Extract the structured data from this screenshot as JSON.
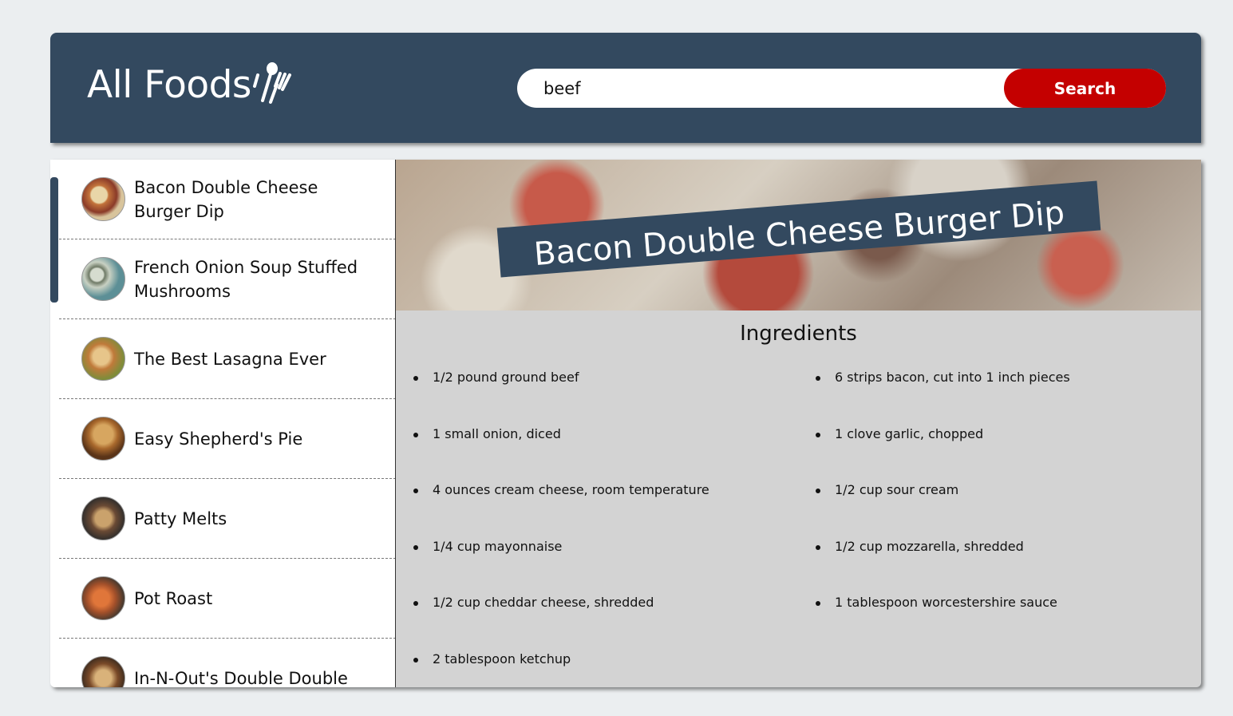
{
  "header": {
    "title": "All Foods",
    "logo_icon": "spoon-fork-icon"
  },
  "search": {
    "value": "beef",
    "button_label": "Search",
    "button_color": "#c40000"
  },
  "colors": {
    "primary": "#33495f",
    "accent": "#c40000",
    "background": "#ebeef0",
    "panel": "#d3d3d3"
  },
  "sidebar": {
    "items": [
      {
        "label": "Bacon Double Cheese Burger Dip",
        "thumb": "bacon-burger-dip-thumbnail"
      },
      {
        "label": "French Onion Soup Stuffed Mushrooms",
        "thumb": "stuffed-mushrooms-thumbnail"
      },
      {
        "label": "The Best Lasagna Ever",
        "thumb": "lasagna-thumbnail"
      },
      {
        "label": "Easy Shepherd's Pie",
        "thumb": "shepherds-pie-thumbnail"
      },
      {
        "label": "Patty Melts",
        "thumb": "patty-melts-thumbnail"
      },
      {
        "label": "Pot Roast",
        "thumb": "pot-roast-thumbnail"
      },
      {
        "label": "In-N-Out's Double Double",
        "thumb": "double-double-thumbnail"
      }
    ]
  },
  "recipe": {
    "title": "Bacon Double Cheese Burger Dip",
    "ingredients_heading": "Ingredients",
    "ingredients": [
      "1/2 pound ground beef",
      "6 strips bacon, cut into 1 inch pieces",
      "1 small onion, diced",
      "1 clove garlic, chopped",
      "4 ounces cream cheese, room temperature",
      "1/2 cup sour cream",
      "1/4 cup mayonnaise",
      "1/2 cup mozzarella, shredded",
      "1/2 cup cheddar cheese, shredded",
      "1 tablespoon worcestershire sauce",
      "2 tablespoon ketchup"
    ]
  }
}
